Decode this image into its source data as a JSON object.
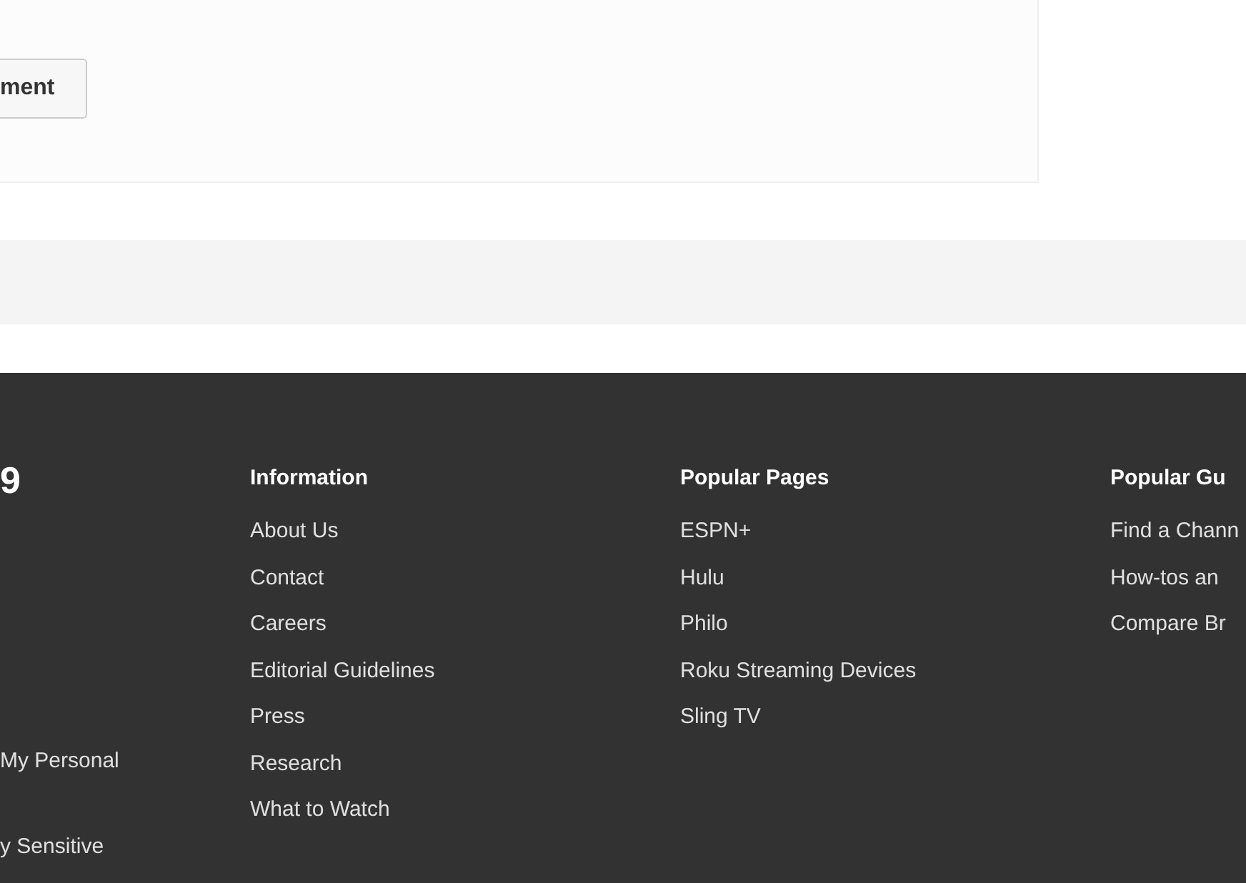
{
  "comment_card": {
    "button": "ment"
  },
  "footer": {
    "brand_fragment": "9",
    "left_links": [
      "My Personal",
      "y Sensitive"
    ],
    "columns": [
      {
        "heading": "Information",
        "links": [
          "About Us",
          "Contact",
          "Careers",
          "Editorial Guidelines",
          "Press",
          "Research",
          "What to Watch"
        ]
      },
      {
        "heading": "Popular Pages",
        "links": [
          "ESPN+",
          "Hulu",
          "Philo",
          "Roku Streaming Devices",
          "Sling TV"
        ]
      },
      {
        "heading": "Popular Gu",
        "links": [
          "Find a Chann",
          "How-tos an",
          "Compare Br"
        ]
      }
    ]
  }
}
